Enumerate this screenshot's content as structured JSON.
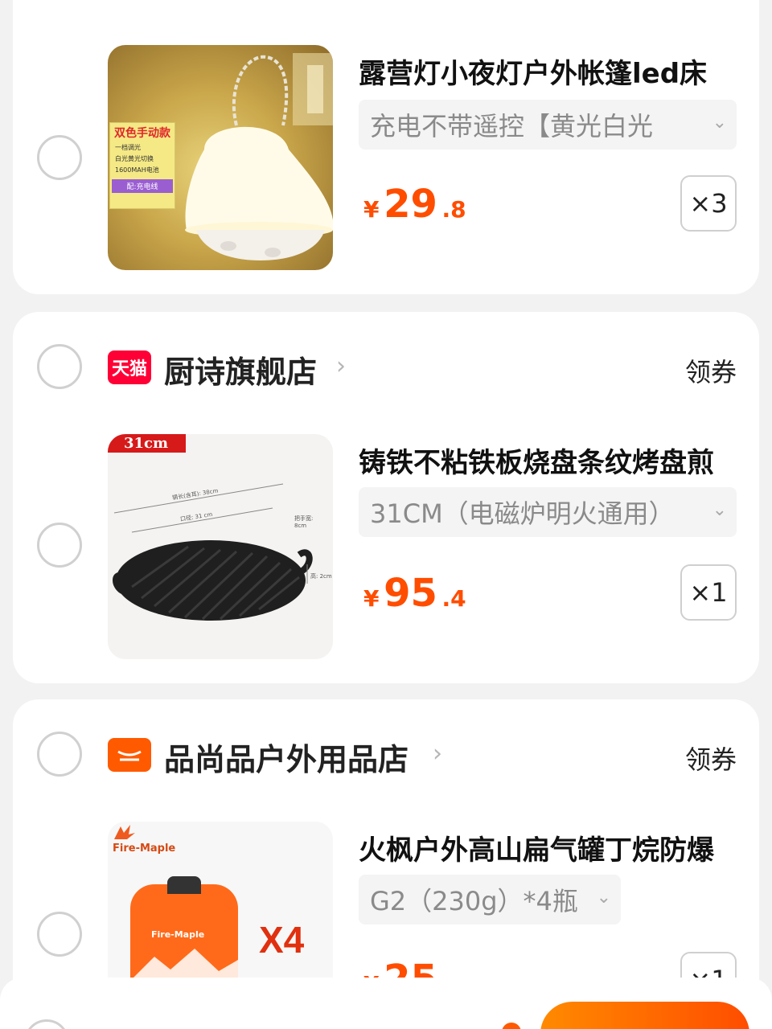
{
  "items": [
    {
      "title": "露营灯小夜灯户外帐篷led床",
      "sku": "充电不带遥控【黄光白光",
      "price_currency": "¥",
      "price_int": "29",
      "price_dec": ".8",
      "qty": "×3",
      "image_text": {
        "heading": "双色手动款",
        "lines": [
          "一档调光",
          "白光黄光切换",
          "1600MAH电池"
        ],
        "badge": "配:充电线"
      }
    },
    {
      "title": "铸铁不粘铁板烧盘条纹烤盘煎",
      "sku": "31CM（电磁炉明火通用）",
      "price_currency": "¥",
      "price_int": "95",
      "price_dec": ".4",
      "qty": "×1",
      "image_text": {
        "tag": "31cm",
        "dim1": "锅长(含耳): 38cm",
        "dim2": "口径: 31 cm",
        "dim3": "把手宽: 8cm",
        "dim4": "高: 2cm"
      }
    },
    {
      "title": "火枫户外高山扁气罐丁烷防爆",
      "sku": "G2（230g）*4瓶",
      "price_currency": "¥",
      "price_int": "25",
      "price_dec": "",
      "qty": "×1",
      "image_text": {
        "brand": "Fire-Maple",
        "can_brand": "Fire-Maple",
        "mult": "X4"
      }
    }
  ],
  "stores": [
    {
      "name": "厨诗旗舰店",
      "icon_text": "天猫",
      "icon": "tmall-icon",
      "coupon": "领券",
      "icon_color": "#ff0036"
    },
    {
      "name": "品尚品户外用品店",
      "icon": "shop-icon",
      "coupon": "领券",
      "icon_color": "#ff5a00"
    }
  ],
  "colors": {
    "price": "#ff4d00",
    "accent": "#ff5a00",
    "background": "#f2f2f2"
  }
}
